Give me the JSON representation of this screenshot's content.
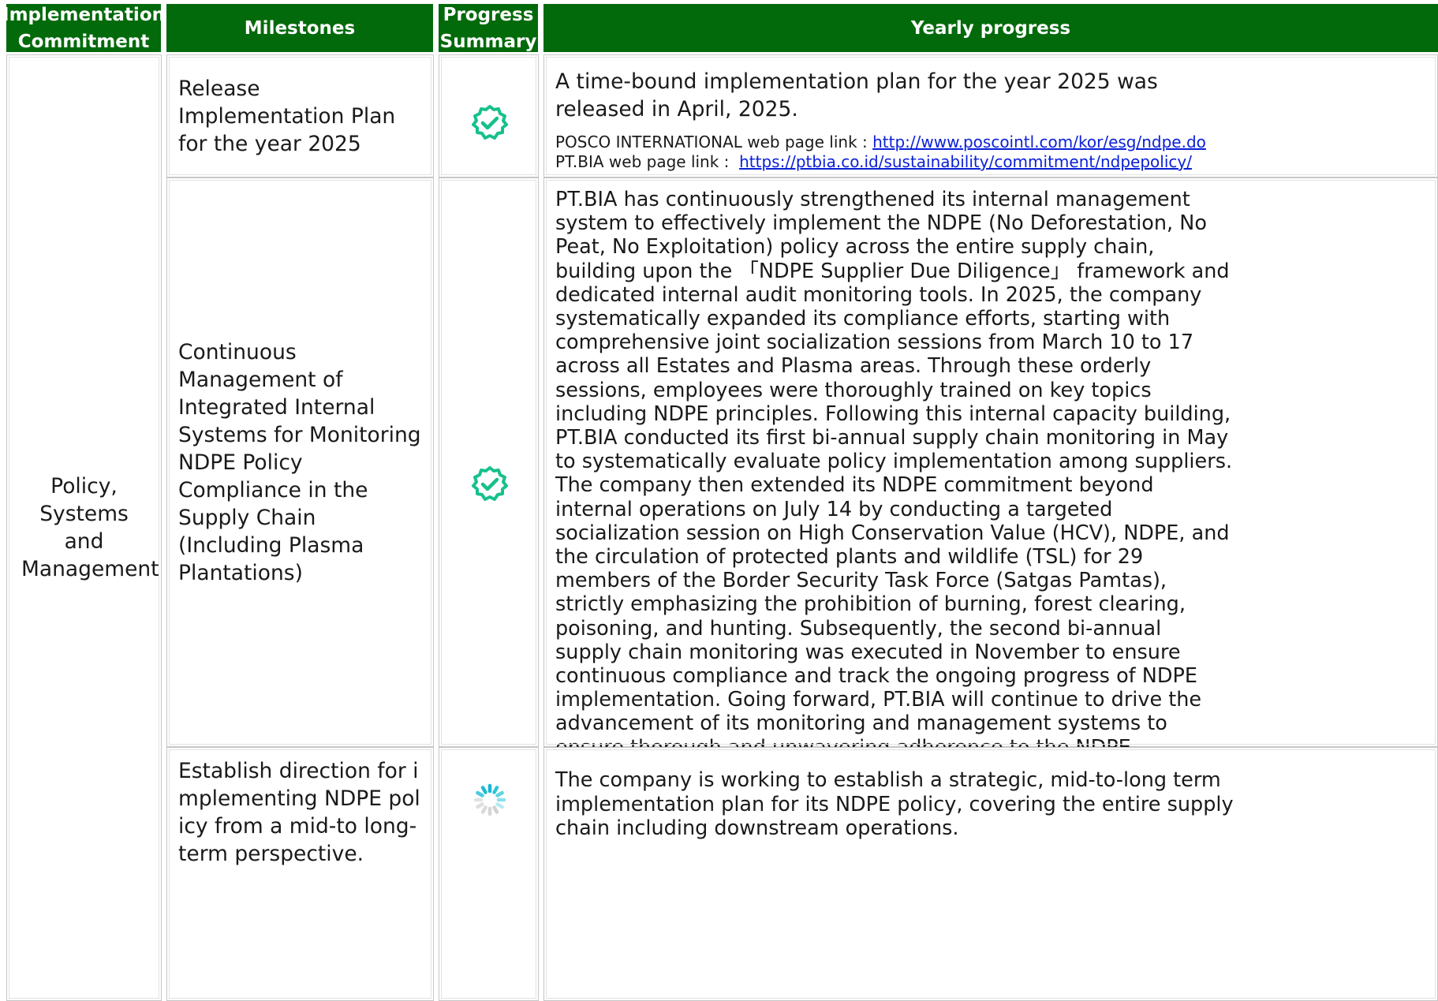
{
  "headers": {
    "commitment": "Implementation Commitment",
    "milestones": "Milestones",
    "progress_summary": "Progress Summary",
    "yearly_progress": "Yearly progress"
  },
  "commitment": "Policy, Systems and Management",
  "rows": [
    {
      "milestone": "Release Implementation Plan for the year 2025",
      "status": "completed",
      "progress_text": "A time-bound implementation plan for the year 2025 was released in April, 2025.",
      "link1_label": "POSCO INTERNATIONAL web page link : ",
      "link1_url": "http://www.poscointl.com/kor/esg/ndpe.do",
      "link2_label": "PT.BIA web page link :  ",
      "link2_url": "https://ptbia.co.id/sustainability/commitment/ndpepolicy/"
    },
    {
      "milestone": "Continuous Management of Integrated Internal Systems for Monitoring NDPE Policy Compliance in the Supply Chain (Including Plasma Plantations)",
      "status": "completed",
      "progress_text": "PT.BIA has continuously strengthened its internal management system to effectively implement the NDPE (No Deforestation, No Peat, No Exploitation) policy across the entire supply chain, building upon the 「NDPE Supplier Due Diligence」 framework and dedicated internal audit monitoring tools. In 2025, the company systematically expanded its compliance efforts, starting with comprehensive joint socialization sessions from March 10 to 17 across all Estates and Plasma areas. Through these orderly sessions, employees were thoroughly trained on key topics including NDPE principles. Following this internal capacity building, PT.BIA conducted its first bi-annual supply chain monitoring in May to systematically evaluate policy implementation among suppliers. The company then extended its NDPE commitment beyond internal operations on July 14 by conducting a targeted socialization session on High Conservation Value (HCV), NDPE, and the circulation of protected plants and wildlife (TSL) for 29 members of the Border Security Task Force (Satgas Pamtas), strictly emphasizing the prohibition of burning, forest clearing, poisoning, and hunting. Subsequently, the second bi-annual supply chain monitoring was executed in November to ensure continuous compliance and track the ongoing progress of NDPE implementation. Going forward, PT.BIA will continue to drive the advancement of its monitoring and management systems to ensure thorough and unwavering adherence to the NDPE principles across its entire supply chain."
    },
    {
      "milestone": "Establish direction for implementing NDPE policy from a mid-to long-term perspective.",
      "status": "in-progress",
      "progress_text": "The company is working to establish a strategic, mid-to-long term implementation plan for its NDPE policy, covering the entire supply chain including downstream operations."
    }
  ],
  "colors": {
    "header_bg": "#036a0b",
    "header_text": "#ffffff",
    "check_green": "#17c08c",
    "link_blue": "#0a1fd8"
  }
}
